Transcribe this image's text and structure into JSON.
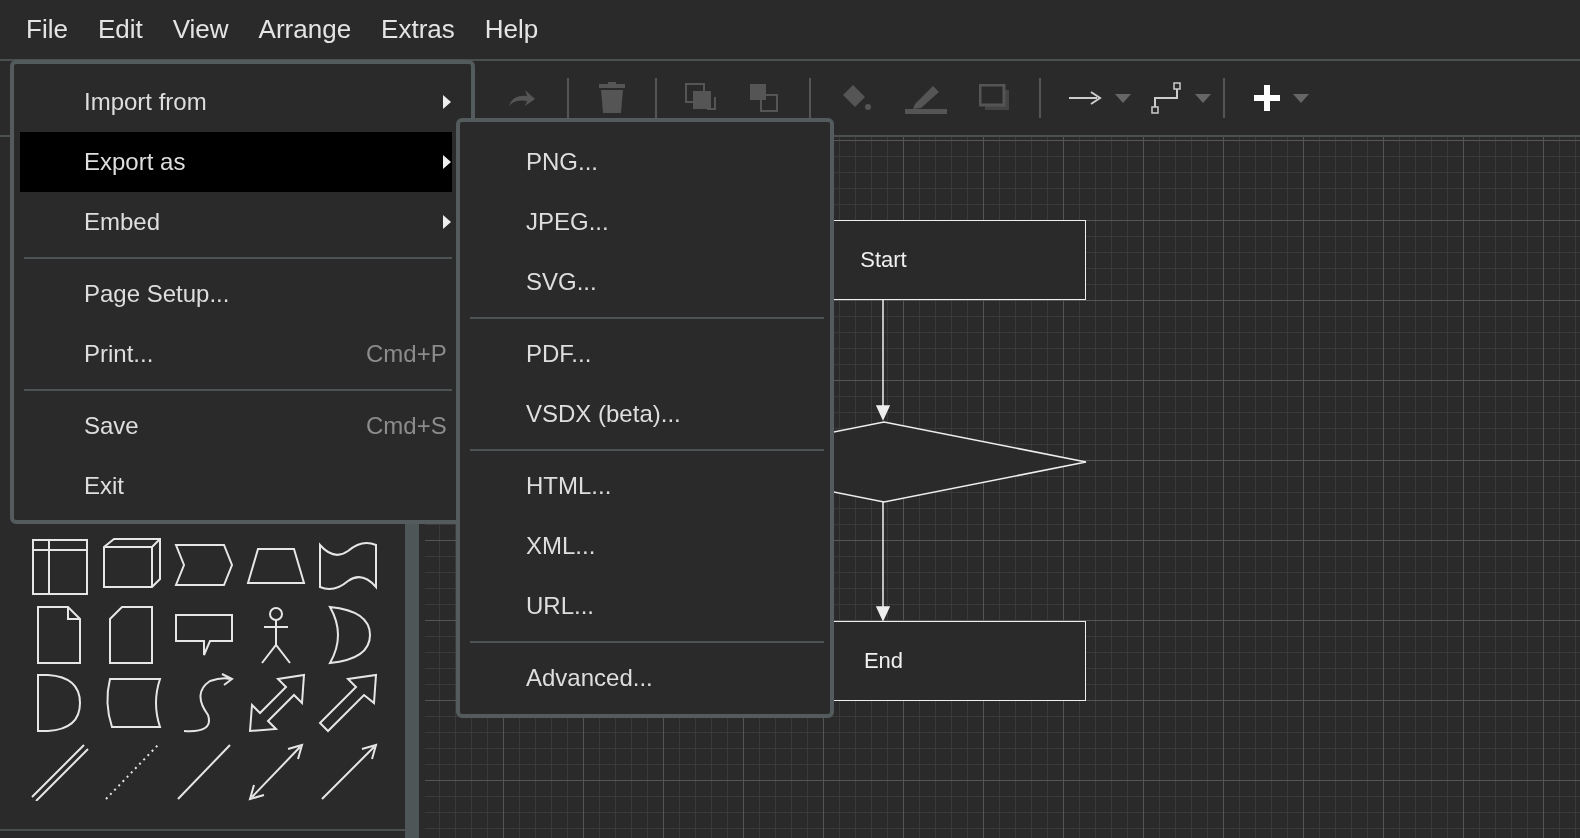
{
  "menubar": [
    {
      "label": "File"
    },
    {
      "label": "Edit"
    },
    {
      "label": "View"
    },
    {
      "label": "Arrange"
    },
    {
      "label": "Extras"
    },
    {
      "label": "Help"
    }
  ],
  "file_menu": {
    "items": [
      {
        "kind": "submenu",
        "label": "Import from",
        "selected": false
      },
      {
        "kind": "submenu",
        "label": "Export as",
        "selected": true
      },
      {
        "kind": "submenu",
        "label": "Embed",
        "selected": false
      },
      {
        "kind": "separator"
      },
      {
        "kind": "item",
        "label": "Page Setup...",
        "selected": false
      },
      {
        "kind": "item",
        "label": "Print...",
        "shortcut": "Cmd+P",
        "selected": false
      },
      {
        "kind": "separator"
      },
      {
        "kind": "item",
        "label": "Save",
        "shortcut": "Cmd+S",
        "selected": false
      },
      {
        "kind": "item",
        "label": "Exit",
        "selected": false
      }
    ]
  },
  "export_submenu": {
    "items": [
      {
        "kind": "item",
        "label": "PNG...",
        "selected": false
      },
      {
        "kind": "item",
        "label": "JPEG...",
        "selected": false
      },
      {
        "kind": "item",
        "label": "SVG...",
        "selected": false
      },
      {
        "kind": "separator"
      },
      {
        "kind": "item",
        "label": "PDF...",
        "selected": false
      },
      {
        "kind": "item",
        "label": "VSDX (beta)...",
        "selected": false
      },
      {
        "kind": "separator"
      },
      {
        "kind": "item",
        "label": "HTML...",
        "selected": false
      },
      {
        "kind": "item",
        "label": "XML...",
        "selected": false
      },
      {
        "kind": "item",
        "label": "URL...",
        "selected": false
      },
      {
        "kind": "separator"
      },
      {
        "kind": "item",
        "label": "Advanced...",
        "selected": false
      }
    ]
  },
  "diagram": {
    "nodes": [
      {
        "kind": "process",
        "label": "Start"
      },
      {
        "kind": "decision"
      },
      {
        "kind": "process",
        "label": "End"
      }
    ]
  }
}
